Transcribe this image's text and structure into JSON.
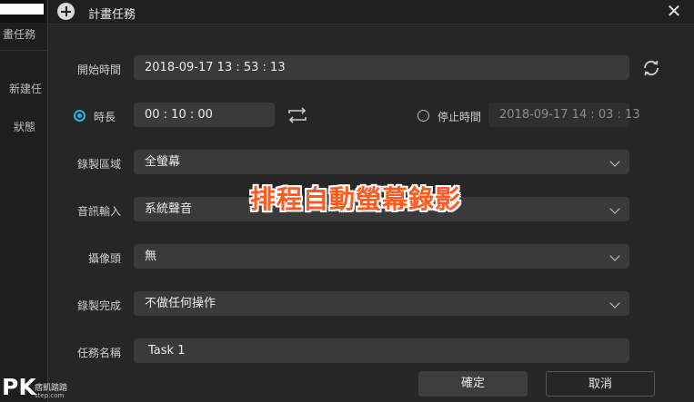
{
  "background": {
    "sidebar_title": "畫任務",
    "sidebar_items": [
      "新建任",
      "狀態"
    ]
  },
  "dialog": {
    "title": "計畫任務",
    "close_glyph": "✕",
    "start_time": {
      "label": "開始時間",
      "value": "2018-09-17 13 : 53 : 13"
    },
    "duration": {
      "label": "時長",
      "value": "00 : 10 : 00",
      "selected": true
    },
    "stop_time": {
      "label": "停止時間",
      "value": "2018-09-17 14 : 03 : 13",
      "selected": false
    },
    "record_area": {
      "label": "錄製區域",
      "value": "全螢幕"
    },
    "audio_input": {
      "label": "音訊輸入",
      "value": "系統聲音"
    },
    "camera": {
      "label": "攝像頭",
      "value": "無"
    },
    "on_complete": {
      "label": "錄製完成",
      "value": "不做任何操作"
    },
    "task_name": {
      "label": "任務名稱",
      "value": "Task 1"
    },
    "confirm_label": "確定",
    "cancel_label": "取消"
  },
  "overlay_caption": "排程自動螢幕錄影",
  "watermark": {
    "logo": "PK",
    "line1": "痞凱踏踏",
    "line2": "step.com"
  },
  "icons": {
    "refresh": "refresh-icon",
    "swap": "swap-icon",
    "add": "plus-circle-icon",
    "close": "close-icon",
    "dropdown": "chevron-down-icon"
  },
  "colors": {
    "accent": "#2bb3e8",
    "caption": "#ff5a1f"
  }
}
